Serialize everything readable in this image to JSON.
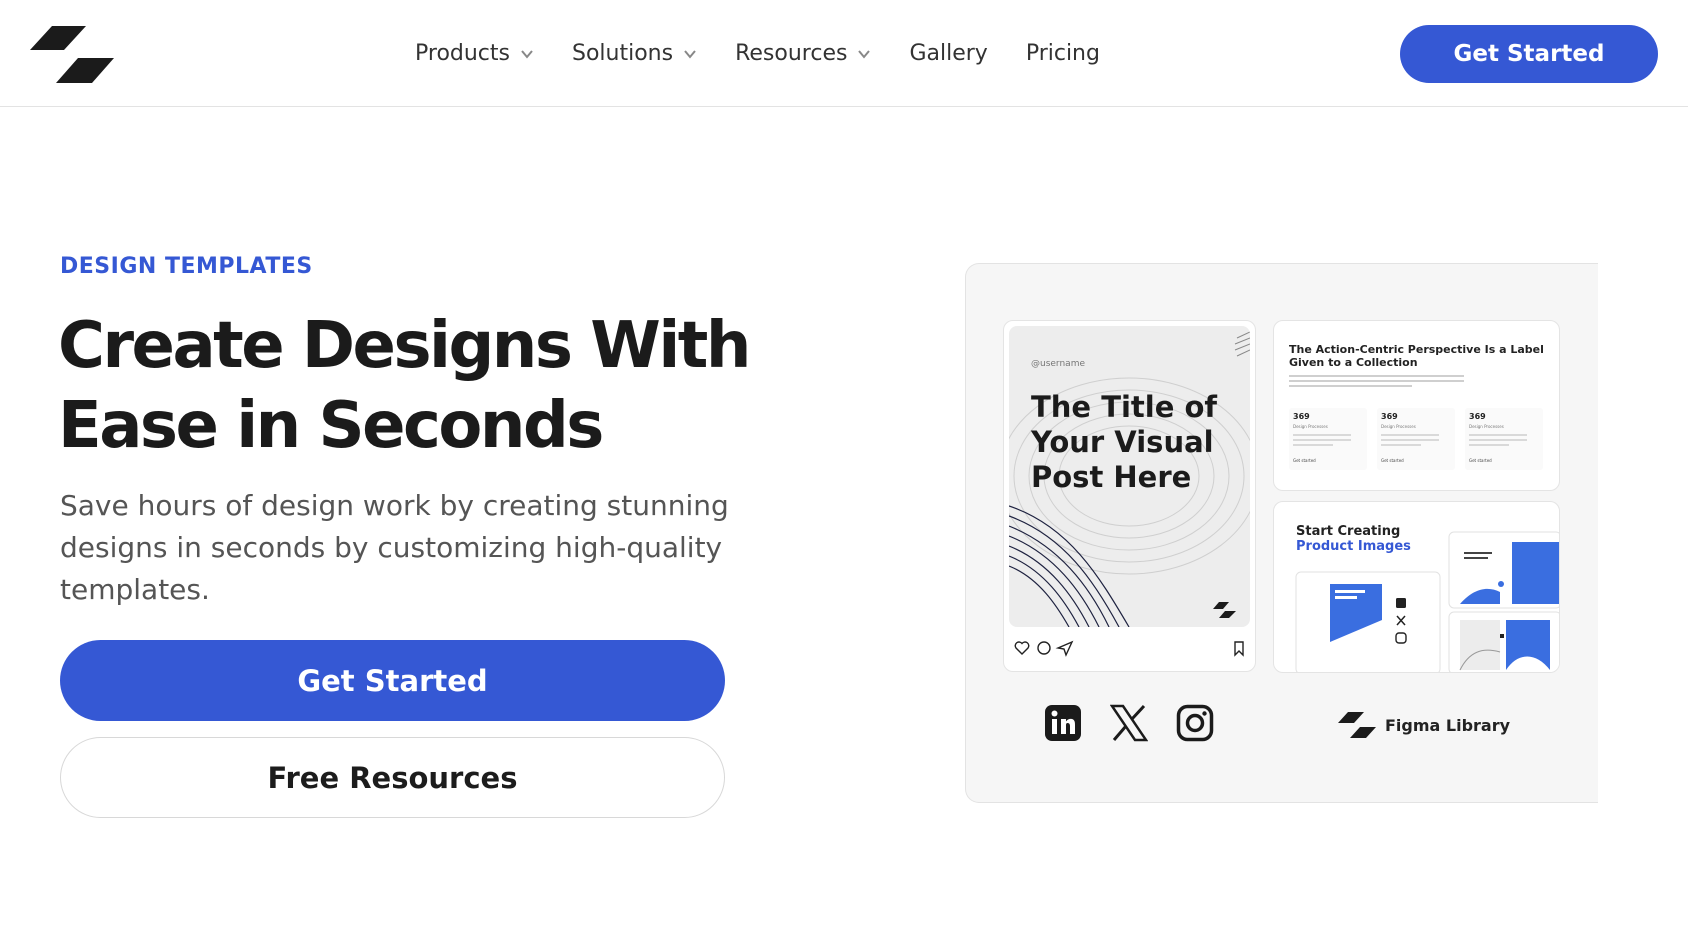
{
  "header": {
    "logo_icon": "brand-logo-icon",
    "nav": [
      {
        "label": "Products",
        "has_dropdown": true
      },
      {
        "label": "Solutions",
        "has_dropdown": true
      },
      {
        "label": "Resources",
        "has_dropdown": true
      },
      {
        "label": "Gallery",
        "has_dropdown": false
      },
      {
        "label": "Pricing",
        "has_dropdown": false
      }
    ],
    "cta_label": "Get Started"
  },
  "hero": {
    "eyebrow": "DESIGN TEMPLATES",
    "headline_line1": "Create Designs With",
    "headline_line2": "Ease in Seconds",
    "subtext": "Save hours of design work by creating stunning designs in seconds by customizing high-quality templates.",
    "primary_button": "Get Started",
    "secondary_button": "Free Resources"
  },
  "preview": {
    "post": {
      "username": "@username",
      "title": "The Title of Your Visual Post Here"
    },
    "doc": {
      "title": "The Action-Centric Perspective Is a Label Given to a Collection",
      "stats": [
        {
          "value": "369",
          "label": "Design Processes",
          "link": "Get started"
        },
        {
          "value": "369",
          "label": "Design Processes",
          "link": "Get started"
        },
        {
          "value": "369",
          "label": "Design Processes",
          "link": "Get started"
        }
      ]
    },
    "product": {
      "title_line1": "Start Creating",
      "title_line2": "Product Images"
    },
    "socials": [
      "linkedin-icon",
      "x-icon",
      "instagram-icon"
    ],
    "figma_label": "Figma Library"
  },
  "colors": {
    "accent": "#3558d4",
    "text": "#1b1b1b",
    "muted": "#555555",
    "panel_bg": "#f6f6f6"
  }
}
